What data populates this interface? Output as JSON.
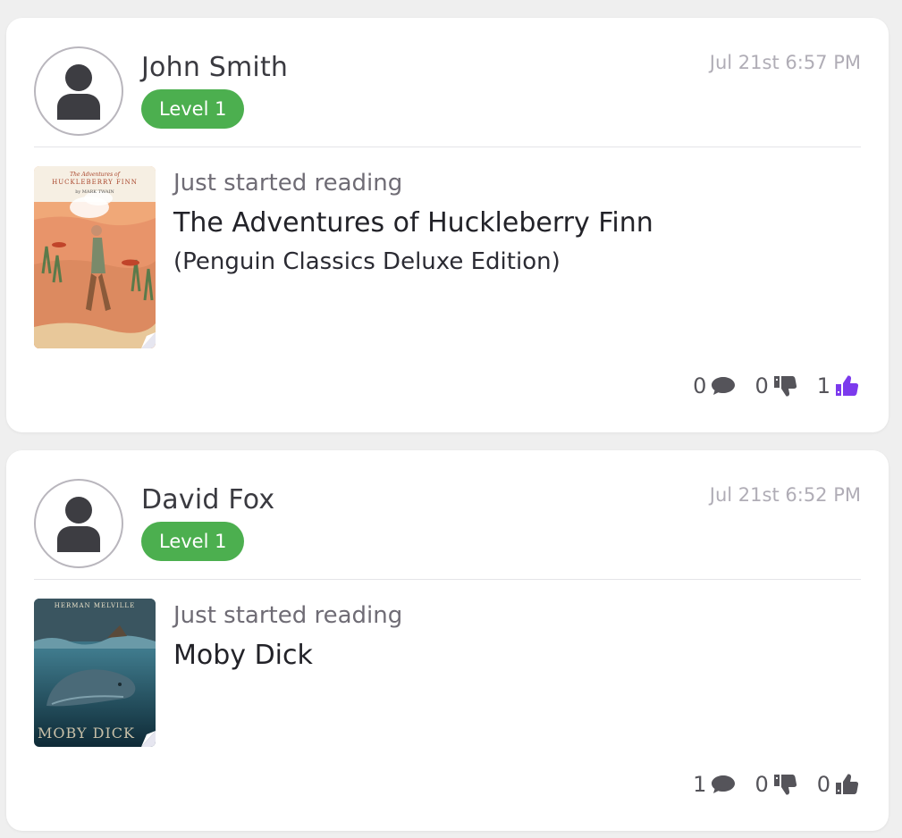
{
  "posts": [
    {
      "user_name": "John Smith",
      "level": "Level 1",
      "timestamp": "Jul 21st 6:57 PM",
      "activity": "Just started reading",
      "book_title": "The Adventures of Huckleberry Finn",
      "book_subtitle": "(Penguin Classics Deluxe Edition)",
      "cover_text_top": "The Adventures of",
      "cover_text_main": "HUCKLEBERRY FINN",
      "cover_text_author": "by MARK TWAIN",
      "comments": "0",
      "dislikes": "0",
      "likes": "1",
      "like_color": "#7c3aed"
    },
    {
      "user_name": "David Fox",
      "level": "Level 1",
      "timestamp": "Jul 21st 6:52 PM",
      "activity": "Just started reading",
      "book_title": "Moby Dick",
      "cover_text_top": "HERMAN MELVILLE",
      "cover_text_main": "MOBY DICK",
      "comments": "1",
      "dislikes": "0",
      "likes": "0",
      "like_color": "#55545a"
    }
  ],
  "colors": {
    "badge_green": "#4caf4f",
    "background": "#efefef",
    "icon_gray": "#55545a",
    "accent_purple": "#7c3aed"
  }
}
